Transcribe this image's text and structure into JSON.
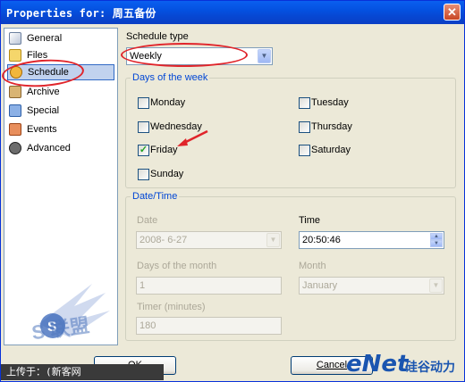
{
  "window": {
    "title": "Properties for: 周五备份",
    "close_label": "✕"
  },
  "sidebar": {
    "items": [
      {
        "label": "General",
        "icon": "general-icon"
      },
      {
        "label": "Files",
        "icon": "files-icon"
      },
      {
        "label": "Schedule",
        "icon": "schedule-icon",
        "selected": true
      },
      {
        "label": "Archive",
        "icon": "archive-icon"
      },
      {
        "label": "Special",
        "icon": "special-icon"
      },
      {
        "label": "Events",
        "icon": "events-icon"
      },
      {
        "label": "Advanced",
        "icon": "advanced-icon"
      }
    ]
  },
  "schedule": {
    "type_label": "Schedule type",
    "type_value": "Weekly"
  },
  "days": {
    "title": "Days of the week",
    "monday": "Monday",
    "tuesday": "Tuesday",
    "wednesday": "Wednesday",
    "thursday": "Thursday",
    "friday": "Friday",
    "saturday": "Saturday",
    "sunday": "Sunday",
    "checked": [
      "Friday"
    ]
  },
  "datetime": {
    "title": "Date/Time",
    "date_label": "Date",
    "date_value": "2008-  6-27",
    "time_label": "Time",
    "time_value": "20:50:46",
    "dom_label": "Days of the month",
    "dom_value": "1",
    "month_label": "Month",
    "month_value": "January",
    "timer_label": "Timer (minutes)",
    "timer_value": "180"
  },
  "buttons": {
    "ok": "OK",
    "cancel": "Cancel"
  },
  "watermark": {
    "left_text": "上传于：(新客网 WWW.XKER.COM)",
    "brand": "eNet",
    "brand_cn": "硅谷动力",
    "stamp": "S 联盟"
  },
  "colors": {
    "title_bar": "#0451e0",
    "group_title": "#0046d5",
    "annotation": "#e0242a",
    "selection": "#c1d2ee"
  }
}
